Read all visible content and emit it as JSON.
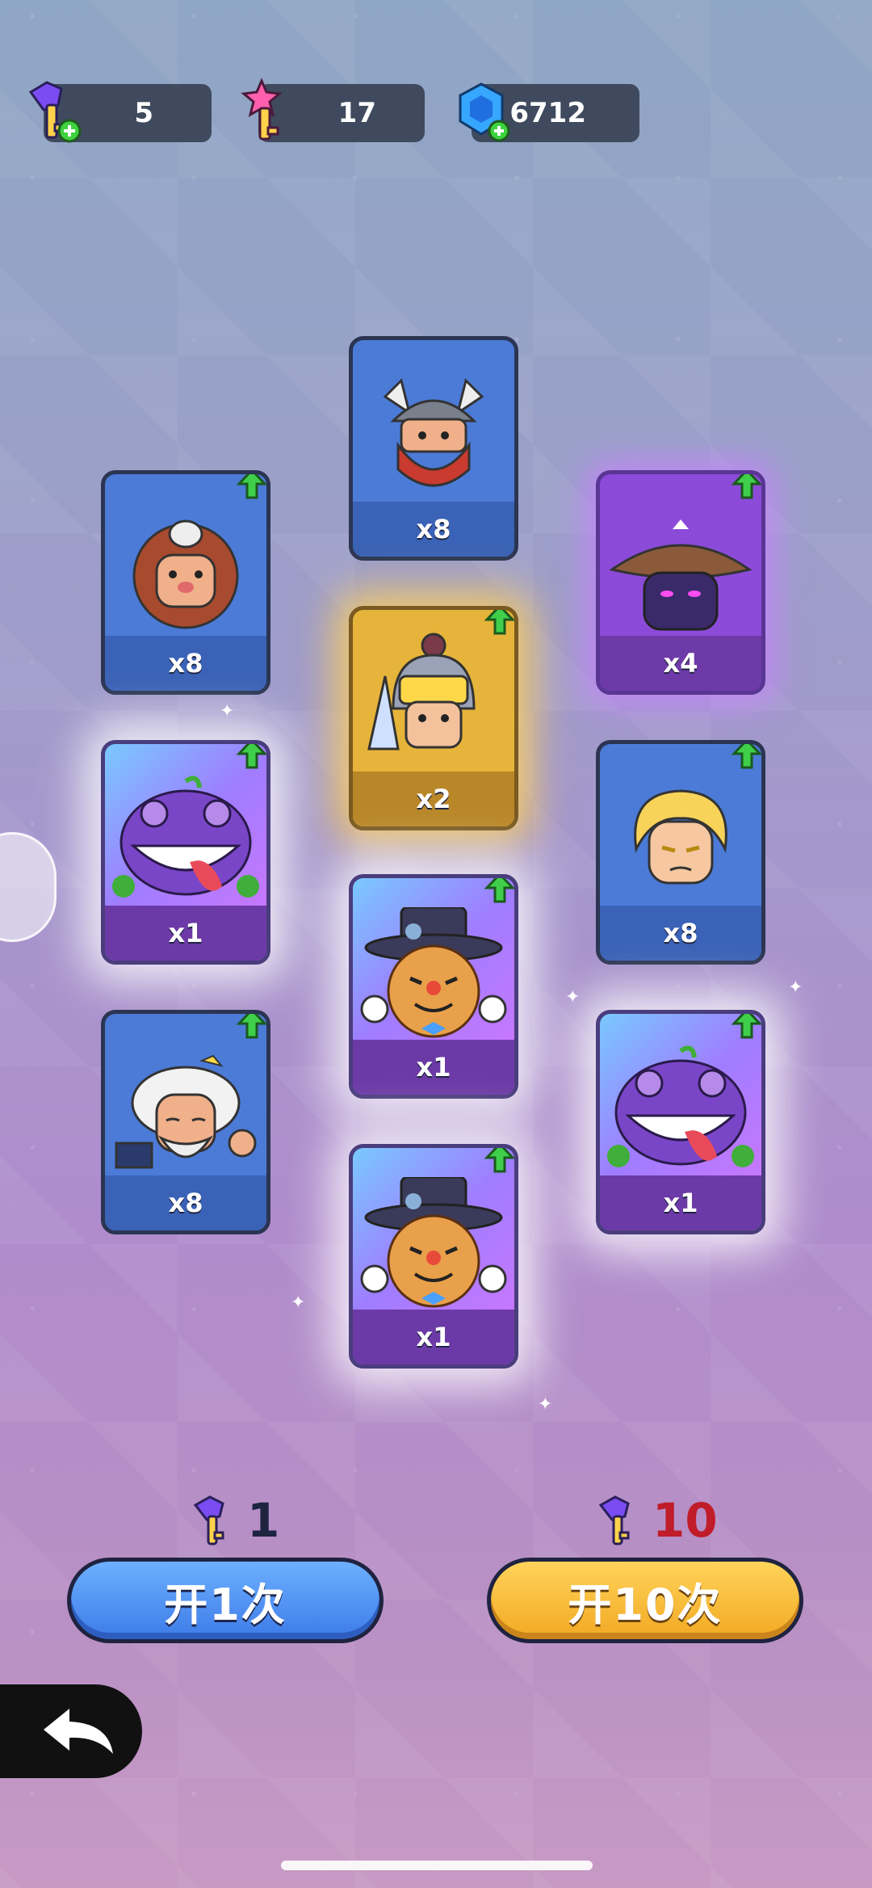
{
  "resources": {
    "keys_purple": "5",
    "keys_star": "17",
    "gems": "6712"
  },
  "cards": [
    {
      "id": "viking",
      "count": "x8",
      "rarity": "blue"
    },
    {
      "id": "caveman",
      "count": "x8",
      "rarity": "blue"
    },
    {
      "id": "ninja",
      "count": "x4",
      "rarity": "purple"
    },
    {
      "id": "knight",
      "count": "x2",
      "rarity": "gold"
    },
    {
      "id": "frog-left",
      "count": "x1",
      "rarity": "rainbow"
    },
    {
      "id": "blonde",
      "count": "x8",
      "rarity": "blue"
    },
    {
      "id": "pumpkin-1",
      "count": "x1",
      "rarity": "rainbow"
    },
    {
      "id": "sage",
      "count": "x8",
      "rarity": "blue"
    },
    {
      "id": "frog-right",
      "count": "x1",
      "rarity": "rainbow"
    },
    {
      "id": "pumpkin-2",
      "count": "x1",
      "rarity": "rainbow"
    }
  ],
  "open_once": {
    "cost": "1",
    "label": "开1次"
  },
  "open_ten": {
    "cost": "10",
    "label": "开10次"
  },
  "icons": [
    "key-plus-icon",
    "star-key-plus-icon",
    "gem-plus-icon",
    "upgrade-arrow-icon",
    "back-arrow-icon"
  ],
  "colors": {
    "accent_blue": "#3d7be8",
    "accent_gold": "#f2a923",
    "cost_red": "#c01c2a"
  }
}
